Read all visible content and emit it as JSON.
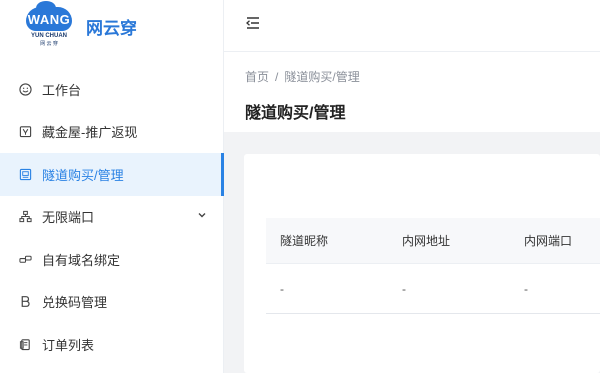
{
  "logo": {
    "text": "WANG",
    "sub": "YUN CHUAN",
    "sub_cn": "网 云 穿"
  },
  "brand": "网云穿",
  "sidebar": {
    "items": [
      {
        "label": "工作台",
        "icon": "smile-icon"
      },
      {
        "label": "藏金屋-推广返现",
        "icon": "gift-box-icon"
      },
      {
        "label": "隧道购买/管理",
        "icon": "tunnel-icon",
        "active": true
      },
      {
        "label": "无限端口",
        "icon": "sitemap-icon",
        "expandable": true
      },
      {
        "label": "自有域名绑定",
        "icon": "link-icon"
      },
      {
        "label": "兑换码管理",
        "icon": "letter-b-icon"
      },
      {
        "label": "订单列表",
        "icon": "document-icon"
      }
    ]
  },
  "breadcrumb": {
    "home": "首页",
    "separator": "/",
    "current": "隧道购买/管理"
  },
  "page_title": "隧道购买/管理",
  "table": {
    "headers": [
      "隧道昵称",
      "内网地址",
      "内网端口"
    ],
    "rows": [
      [
        "-",
        "-",
        "-"
      ]
    ]
  },
  "colors": {
    "accent": "#2a82e4",
    "active_bg": "#e9f3fd",
    "content_bg": "#f2f3f5"
  }
}
